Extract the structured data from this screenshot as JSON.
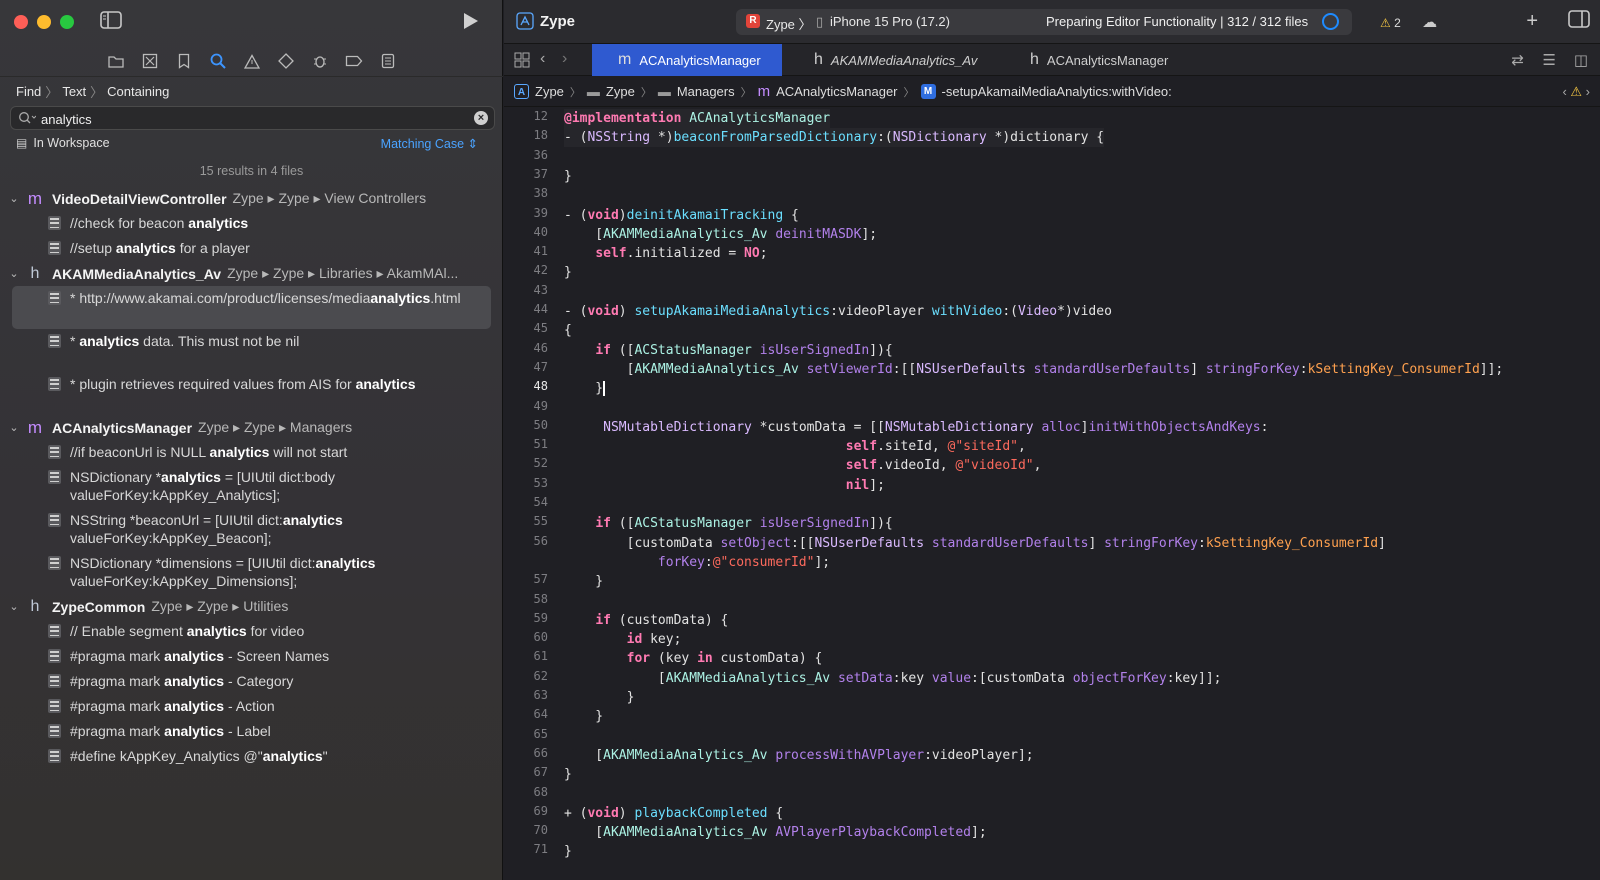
{
  "left": {
    "find_path": [
      "Find",
      "Text",
      "Containing"
    ],
    "search": {
      "value": "analytics",
      "placeholder": ""
    },
    "scope": "In Workspace",
    "matching": "Matching Case",
    "results_summary": "15 results in 4 files",
    "groups": [
      {
        "type": "m",
        "name": "VideoDetailViewController",
        "path": "Zype ▸ Zype ▸ View Controllers",
        "matches": [
          [
            "//check for beacon ",
            "analytics",
            ""
          ],
          [
            "//setup ",
            "analytics",
            " for a player"
          ]
        ]
      },
      {
        "type": "h",
        "name": "AKAMMediaAnalytics_Av",
        "path": "Zype ▸ Zype ▸ Libraries ▸ AkamMAl...",
        "matches": [
          [
            "* http://www.akamai.com/product/licenses/media",
            "analytics",
            ".html"
          ],
          [
            "*                   ",
            "analytics",
            " data. This must not be nil"
          ],
          [
            "*      plugin retrieves required values from AIS for ",
            "analytics",
            ""
          ]
        ]
      },
      {
        "type": "m",
        "name": "ACAnalyticsManager",
        "path": "Zype ▸ Zype ▸ Managers",
        "matches": [
          [
            "//if beaconUrl is NULL ",
            "analytics",
            " will not start"
          ],
          [
            "NSDictionary *",
            "analytics",
            " = [UIUtil dict:body valueForKey:kAppKey_Analytics];"
          ],
          [
            "NSString *beaconUrl = [UIUtil dict:",
            "analytics",
            " valueForKey:kAppKey_Beacon];"
          ],
          [
            "NSDictionary *dimensions = [UIUtil dict:",
            "analytics",
            " valueForKey:kAppKey_Dimensions];"
          ]
        ]
      },
      {
        "type": "h",
        "name": "ZypeCommon",
        "path": "Zype ▸ Zype ▸ Utilities",
        "matches": [
          [
            "// Enable segment ",
            "analytics",
            " for video"
          ],
          [
            "#pragma mark ",
            "analytics",
            " - Screen Names"
          ],
          [
            "#pragma mark ",
            "analytics",
            " - Category"
          ],
          [
            "#pragma mark ",
            "analytics",
            " - Action"
          ],
          [
            "#pragma mark ",
            "analytics",
            " - Label"
          ],
          [
            "#define kAppKey_Analytics         @\"",
            "analytics",
            "\""
          ]
        ]
      }
    ]
  },
  "titlebar": {
    "project": "Zype",
    "scheme": "Zype",
    "device": "iPhone 15 Pro (17.2)",
    "status": "Preparing Editor Functionality | 312 / 312 files",
    "warnings": "2"
  },
  "tabs": [
    "ACAnalyticsManager",
    "AKAMMediaAnalytics_Av",
    "ACAnalyticsManager"
  ],
  "jumpbar": [
    "Zype",
    "Zype",
    "Managers",
    "ACAnalyticsManager",
    "-setupAkamaiMediaAnalytics:withVideo:"
  ],
  "code": [
    {
      "n": "12",
      "t": "@implementation ACAnalyticsManager"
    },
    {
      "n": "18",
      "t": "- (NSString *)beaconFromParsedDictionary:(NSDictionary *)dictionary {"
    },
    {
      "n": "36",
      "t": ""
    },
    {
      "n": "37",
      "t": "}"
    },
    {
      "n": "38",
      "t": ""
    },
    {
      "n": "39",
      "t": "- (void)deinitAkamaiTracking {"
    },
    {
      "n": "40",
      "t": "    [AKAMMediaAnalytics_Av deinitMASDK];"
    },
    {
      "n": "41",
      "t": "    self.initialized = NO;"
    },
    {
      "n": "42",
      "t": "}"
    },
    {
      "n": "43",
      "t": ""
    },
    {
      "n": "44",
      "t": "- (void) setupAkamaiMediaAnalytics:videoPlayer withVideo:(Video*)video"
    },
    {
      "n": "45",
      "t": "{"
    },
    {
      "n": "46",
      "t": "    if ([ACStatusManager isUserSignedIn]){"
    },
    {
      "n": "47",
      "t": "        [AKAMMediaAnalytics_Av setViewerId:[[NSUserDefaults standardUserDefaults] stringForKey:kSettingKey_ConsumerId]];"
    },
    {
      "n": "48",
      "t": "    }"
    },
    {
      "n": "49",
      "t": ""
    },
    {
      "n": "50",
      "t": "     NSMutableDictionary *customData = [[NSMutableDictionary alloc]initWithObjectsAndKeys:"
    },
    {
      "n": "51",
      "t": "                                    self.siteId, @\"siteId\","
    },
    {
      "n": "52",
      "t": "                                    self.videoId, @\"videoId\","
    },
    {
      "n": "53",
      "t": "                                    nil];"
    },
    {
      "n": "54",
      "t": ""
    },
    {
      "n": "55",
      "t": "    if ([ACStatusManager isUserSignedIn]){"
    },
    {
      "n": "56",
      "t": "        [customData setObject:[[NSUserDefaults standardUserDefaults] stringForKey:kSettingKey_ConsumerId]"
    },
    {
      "n": "",
      "t": "            forKey:@\"consumerId\"];"
    },
    {
      "n": "57",
      "t": "    }"
    },
    {
      "n": "58",
      "t": ""
    },
    {
      "n": "59",
      "t": "    if (customData) {"
    },
    {
      "n": "60",
      "t": "        id key;"
    },
    {
      "n": "61",
      "t": "        for (key in customData) {"
    },
    {
      "n": "62",
      "t": "            [AKAMMediaAnalytics_Av setData:key value:[customData objectForKey:key]];"
    },
    {
      "n": "63",
      "t": "        }"
    },
    {
      "n": "64",
      "t": "    }"
    },
    {
      "n": "65",
      "t": ""
    },
    {
      "n": "66",
      "t": "    [AKAMMediaAnalytics_Av processWithAVPlayer:videoPlayer];"
    },
    {
      "n": "67",
      "t": "}"
    },
    {
      "n": "68",
      "t": ""
    },
    {
      "n": "69",
      "t": "+ (void) playbackCompleted {"
    },
    {
      "n": "70",
      "t": "    [AKAMMediaAnalytics_Av AVPlayerPlaybackCompleted];"
    },
    {
      "n": "71",
      "t": "}"
    }
  ]
}
